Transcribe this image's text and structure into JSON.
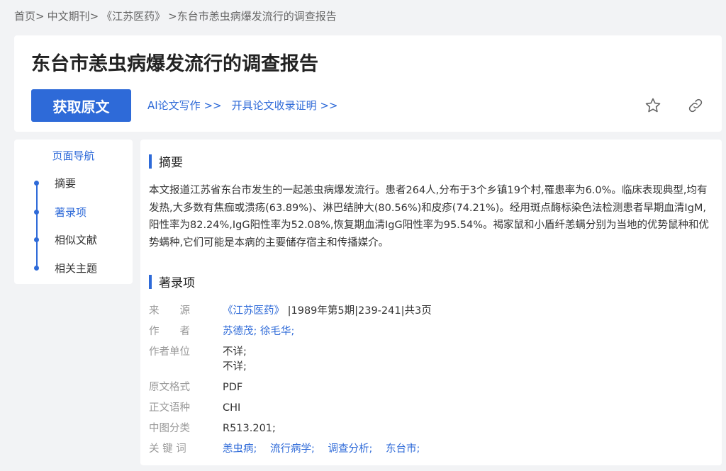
{
  "breadcrumb": [
    "首页>",
    "中文期刊>",
    "《江苏医药》",
    ">东台市恙虫病爆发流行的调查报告"
  ],
  "header": {
    "title": "东台市恙虫病爆发流行的调查报告",
    "get_button": "获取原文",
    "links": [
      "AI论文写作 >>",
      "开具论文收录证明 >>"
    ]
  },
  "nav": {
    "title": "页面导航",
    "items": [
      "摘要",
      "著录项",
      "相似文献",
      "相关主题"
    ],
    "active_index": 1
  },
  "abstract": {
    "heading": "摘要",
    "text": "本文报道江苏省东台市发生的一起恙虫病爆发流行。患者264人,分布于3个乡镇19个村,罹患率为6.0%。临床表现典型,均有发热,大多数有焦痂或溃疡(63.89%)、淋巴结肿大(80.56%)和皮疹(74.21%)。经用斑点酶标染色法检测患者早期血清IgM,阳性率为82.24%,IgG阳性率为52.08%,恢复期血清IgG阳性率为95.54%。褐家鼠和小盾纤恙螨分别为当地的优势鼠种和优势螨种,它们可能是本病的主要储存宿主和传播媒介。"
  },
  "record": {
    "heading": "著录项",
    "source_label": "来　　源",
    "source_journal": "《江苏医药》",
    "source_detail": "|1989年第5期|239-241|共3页",
    "author_label": "作　　者",
    "authors": "苏德茂; 徐毛华;",
    "affil_label": "作者单位",
    "affil_1": "不详;",
    "affil_2": "不详;",
    "format_label": "原文格式",
    "format": "PDF",
    "lang_label": "正文语种",
    "lang": "CHI",
    "class_label": "中图分类",
    "class": "R513.201;",
    "kw_label": "关 键 词",
    "keywords": [
      "恙虫病;",
      "流行病学;",
      "调查分析;",
      "东台市;"
    ]
  },
  "colors": {
    "accent": "#2e6ad8",
    "background": "#f2f3f5"
  },
  "icons": [
    "star-icon",
    "link-icon"
  ]
}
